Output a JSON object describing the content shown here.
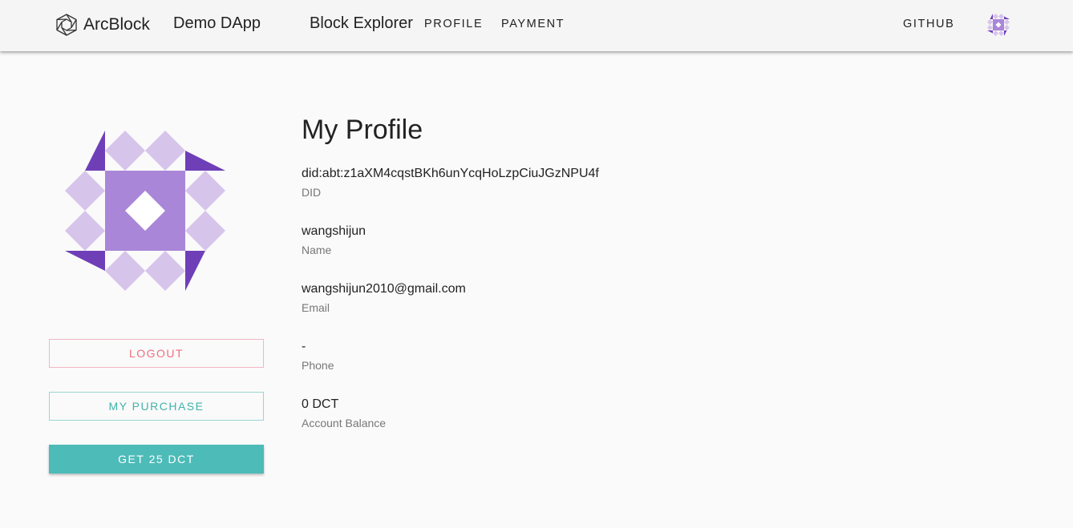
{
  "header": {
    "brand": "ArcBlock",
    "app_name": "Demo DApp",
    "explorer": "Block Explorer",
    "nav": [
      "PROFILE",
      "PAYMENT"
    ],
    "github": "GITHUB"
  },
  "sidebar": {
    "buttons": {
      "logout": "LOGOUT",
      "purchase": "MY PURCHASE",
      "get_token": "GET 25 DCT"
    }
  },
  "profile": {
    "title": "My Profile",
    "fields": [
      {
        "value": "did:abt:z1aXM4cqstBKh6unYcqHoLzpCiuJGzNPU4f",
        "label": "DID"
      },
      {
        "value": "wangshijun",
        "label": "Name"
      },
      {
        "value": "wangshijun2010@gmail.com",
        "label": "Email"
      },
      {
        "value": "-",
        "label": "Phone"
      },
      {
        "value": "0 DCT",
        "label": "Account Balance"
      }
    ]
  },
  "colors": {
    "accent": "#4dbbb8",
    "danger": "#ef6f7f",
    "avatar_dark": "#6f3fb8",
    "avatar_mid": "#a986d8",
    "avatar_light": "#d6c4eb"
  }
}
